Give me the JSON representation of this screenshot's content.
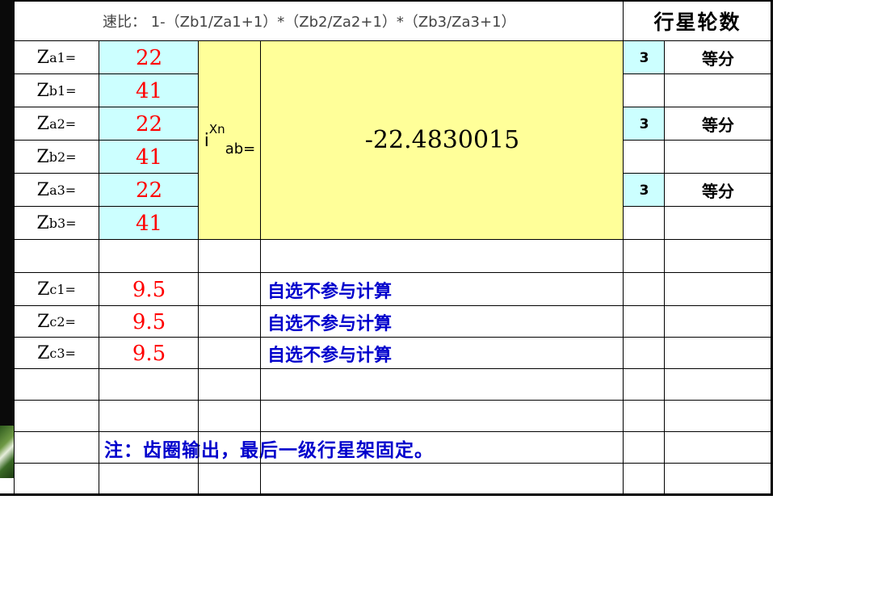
{
  "formula": "速比：  1-（Zb1/Za1+1）*（Zb2/Za2+1）*（Zb3/Za3+1）",
  "planet_header": "行星轮数",
  "inputs": [
    {
      "label_main": "Z",
      "label_sub": "a1=",
      "value": "22"
    },
    {
      "label_main": "Z",
      "label_sub": "b1=",
      "value": "41"
    },
    {
      "label_main": "Z",
      "label_sub": "a2=",
      "value": "22"
    },
    {
      "label_main": "Z",
      "label_sub": "b2=",
      "value": "41"
    },
    {
      "label_main": "Z",
      "label_sub": "a3=",
      "value": "22"
    },
    {
      "label_main": "Z",
      "label_sub": "b3=",
      "value": "41"
    }
  ],
  "ratio_label": {
    "i": "i",
    "sup": "Xn",
    "sub": "ab="
  },
  "ratio_value": "-22.4830015",
  "planets": [
    {
      "count": "3",
      "note": "等分"
    },
    {
      "count": "3",
      "note": "等分"
    },
    {
      "count": "3",
      "note": "等分"
    }
  ],
  "optional": [
    {
      "label_main": "Z",
      "label_sub": "c1=",
      "value": "9.5",
      "note": "自选不参与计算"
    },
    {
      "label_main": "Z",
      "label_sub": "c2=",
      "value": "9.5",
      "note": "自选不参与计算"
    },
    {
      "label_main": "Z",
      "label_sub": "c3=",
      "value": "9.5",
      "note": "自选不参与计算"
    }
  ],
  "footer_note": "注：齿圈输出，最后一级行星架固定。",
  "colors": {
    "input_fill": "#ccffff",
    "result_fill": "#ffff99",
    "value_red": "#ff0000",
    "note_blue": "#0000cc"
  }
}
